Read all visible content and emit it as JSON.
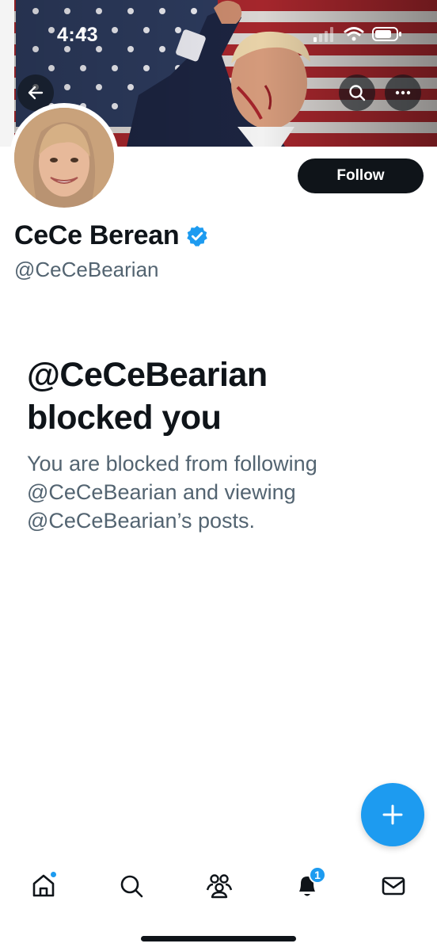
{
  "status_bar": {
    "time": "4:43"
  },
  "header": {
    "banner_image": "american-flag-with-raised-fist-figure",
    "back_icon": "arrow-left-icon",
    "search_icon": "search-icon",
    "more_icon": "more-horizontal-icon"
  },
  "profile": {
    "display_name": "CeCe Berean",
    "handle": "@CeCeBearian",
    "verified": true,
    "follow_label": "Follow"
  },
  "blocked": {
    "title_line1": "@CeCeBearian",
    "title_line2": "blocked you",
    "body_line1": "You are blocked from following",
    "body_line2": "@CeCeBearian and viewing",
    "body_line3": "@CeCeBearian’s posts."
  },
  "fab": {
    "icon": "plus-icon"
  },
  "bottom_nav": {
    "items": [
      {
        "icon": "home-icon",
        "has_dot": true
      },
      {
        "icon": "search-icon"
      },
      {
        "icon": "communities-icon"
      },
      {
        "icon": "notifications-icon",
        "badge": "1"
      },
      {
        "icon": "messages-icon"
      }
    ]
  },
  "colors": {
    "accent": "#1d9bf0",
    "text_primary": "#0f1419",
    "text_secondary": "#536471",
    "follow_bg": "#0f1419"
  }
}
